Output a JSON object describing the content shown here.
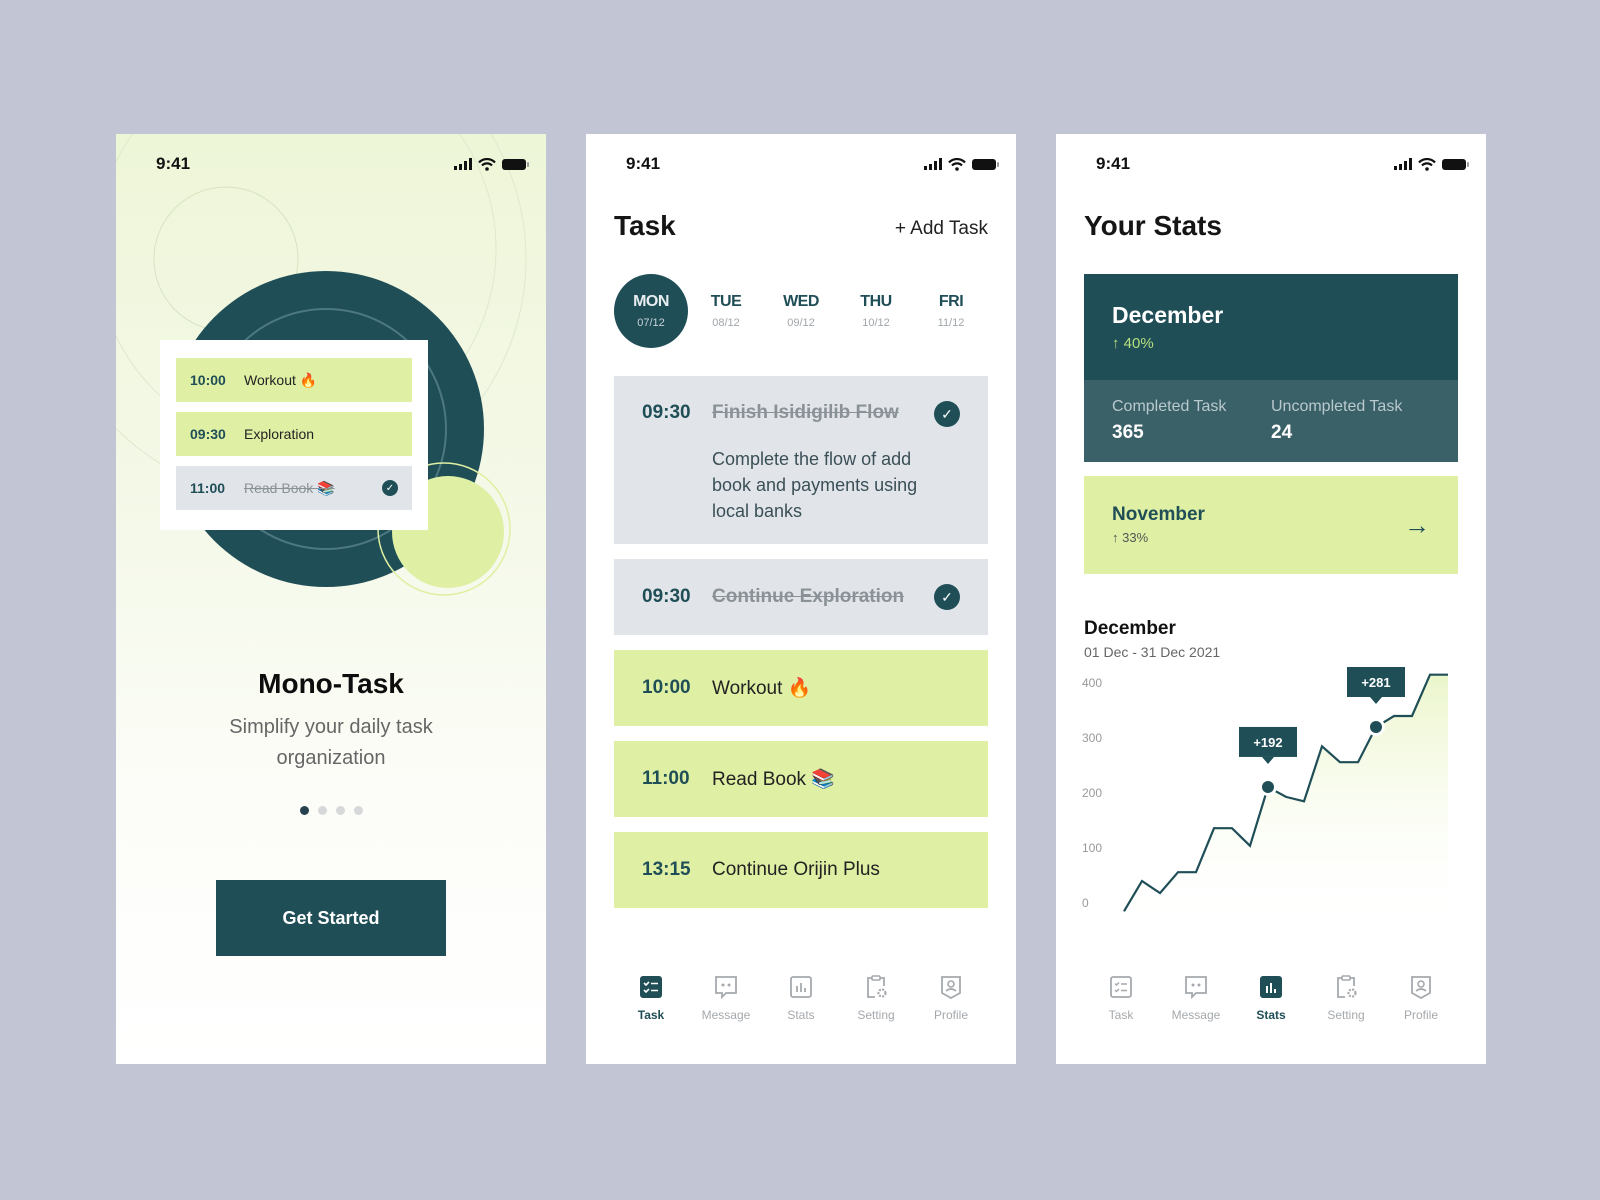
{
  "status_bar": {
    "time": "9:41"
  },
  "onboarding": {
    "preview_tasks": [
      {
        "time": "10:00",
        "name": "Workout 🔥",
        "done": false
      },
      {
        "time": "09:30",
        "name": "Exploration",
        "done": false
      },
      {
        "time": "11:00",
        "name": "Read Book 📚",
        "done": true
      }
    ],
    "title": "Mono-Task",
    "subtitle": "Simplify your daily task organization",
    "page_count": 4,
    "current_page": 1,
    "cta_label": "Get Started"
  },
  "task_screen": {
    "title": "Task",
    "add_label": "+ Add Task",
    "days": [
      {
        "name": "MON",
        "date": "07/12",
        "active": true
      },
      {
        "name": "TUE",
        "date": "08/12",
        "active": false
      },
      {
        "name": "WED",
        "date": "09/12",
        "active": false
      },
      {
        "name": "THU",
        "date": "10/12",
        "active": false
      },
      {
        "name": "FRI",
        "date": "11/12",
        "active": false
      }
    ],
    "tasks": [
      {
        "time": "09:30",
        "name": "Finish Isidigilib Flow",
        "description": "Complete the flow of add book and payments using local banks",
        "done": true
      },
      {
        "time": "09:30",
        "name": "Continue Exploration",
        "description": "",
        "done": true
      },
      {
        "time": "10:00",
        "name": "Workout 🔥",
        "description": "",
        "done": false
      },
      {
        "time": "11:00",
        "name": "Read Book 📚",
        "description": "",
        "done": false
      },
      {
        "time": "13:15",
        "name": "Continue Orijin Plus",
        "description": "",
        "done": false
      }
    ]
  },
  "stats_screen": {
    "title": "Your Stats",
    "current_month": {
      "name": "December",
      "change": "↑ 40%",
      "completed_label": "Completed Task",
      "completed_value": "365",
      "uncompleted_label": "Uncompleted Task",
      "uncompleted_value": "24"
    },
    "previous_month": {
      "name": "November",
      "change": "↑ 33%",
      "arrow": "→"
    },
    "chart_title": "December",
    "chart_range": "01 Dec - 31 Dec 2021"
  },
  "chart_data": {
    "type": "line",
    "title": "December",
    "subtitle": "01 Dec - 31 Dec 2021",
    "xlabel": "",
    "ylabel": "",
    "yticks": [
      400,
      300,
      200,
      100,
      0
    ],
    "ylim": [
      0,
      400
    ],
    "grid": false,
    "values": [
      -15,
      40,
      18,
      56,
      56,
      136,
      136,
      104,
      211,
      193,
      185,
      285,
      256,
      256,
      320,
      340,
      340,
      415,
      415
    ],
    "annotations": [
      {
        "index": 8,
        "label": "+192"
      },
      {
        "index": 14,
        "label": "+281"
      }
    ],
    "line_color": "#1f4e57",
    "fill_color": "#eaf5c8"
  },
  "nav": {
    "items": [
      {
        "label": "Task",
        "icon": "task-list-icon"
      },
      {
        "label": "Message",
        "icon": "message-icon"
      },
      {
        "label": "Stats",
        "icon": "stats-icon"
      },
      {
        "label": "Setting",
        "icon": "setting-icon"
      },
      {
        "label": "Profile",
        "icon": "profile-icon"
      }
    ]
  },
  "colors": {
    "primary": "#1f4e57",
    "accent": "#dff0a4",
    "done_bg": "#e1e5e9",
    "background": "#c2c6d4"
  }
}
